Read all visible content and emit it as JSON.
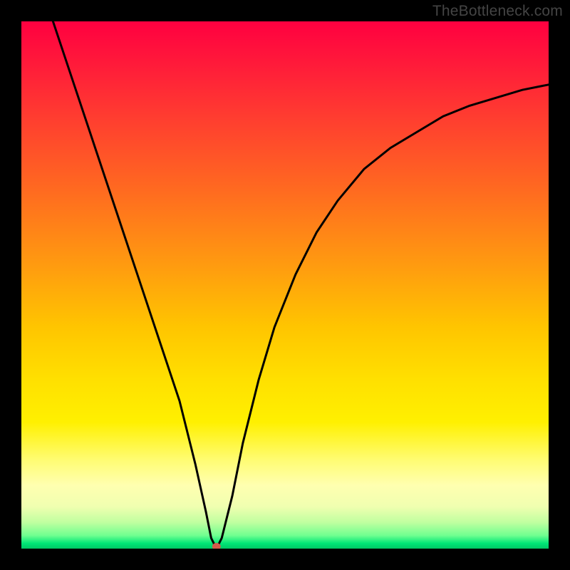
{
  "watermark": "TheBottleneck.com",
  "chart_data": {
    "type": "line",
    "title": "",
    "xlabel": "",
    "ylabel": "",
    "xlim": [
      0,
      100
    ],
    "ylim": [
      0,
      100
    ],
    "grid": false,
    "legend": false,
    "series": [
      {
        "name": "curve",
        "x": [
          6,
          10,
          14,
          18,
          22,
          26,
          30,
          33,
          35,
          36,
          37,
          38,
          40,
          42,
          45,
          48,
          52,
          56,
          60,
          65,
          70,
          75,
          80,
          85,
          90,
          95,
          100
        ],
        "y": [
          100,
          88,
          76,
          64,
          52,
          40,
          28,
          16,
          7,
          2,
          0,
          2,
          10,
          20,
          32,
          42,
          52,
          60,
          66,
          72,
          76,
          79,
          82,
          84,
          85.5,
          87,
          88
        ]
      }
    ],
    "marker": {
      "x": 37,
      "y": 0,
      "color": "#d45a4a"
    },
    "background_gradient": {
      "direction": "vertical",
      "stops": [
        {
          "pos": 0.0,
          "color": "#ff0040"
        },
        {
          "pos": 0.32,
          "color": "#ff6a20"
        },
        {
          "pos": 0.58,
          "color": "#ffc500"
        },
        {
          "pos": 0.83,
          "color": "#fffc70"
        },
        {
          "pos": 0.95,
          "color": "#c0ffa0"
        },
        {
          "pos": 1.0,
          "color": "#00c864"
        }
      ]
    }
  }
}
